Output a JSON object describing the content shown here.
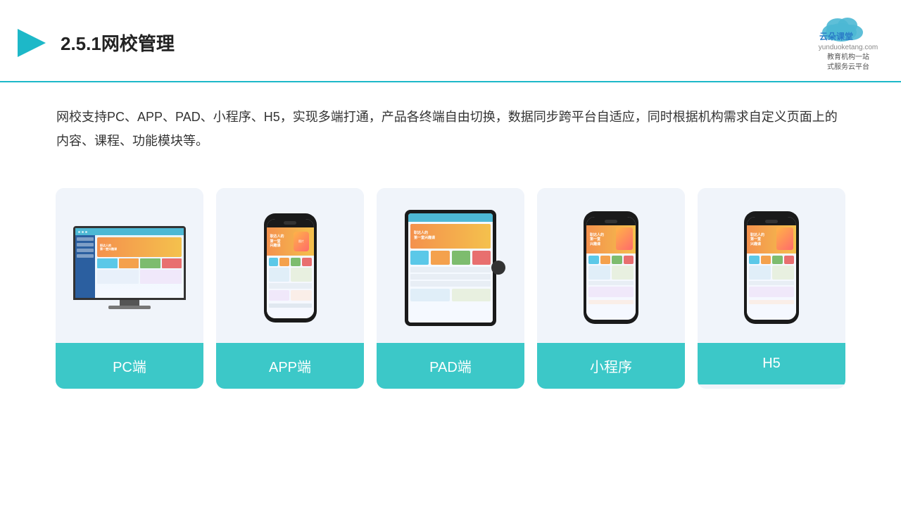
{
  "header": {
    "title": "2.5.1网校管理",
    "logo_name": "云朵课堂",
    "logo_url": "yunduoketang.com",
    "logo_tagline": "教育机构一站\n式服务云平台"
  },
  "description": {
    "text": "网校支持PC、APP、PAD、小程序、H5，实现多端打通，产品各终端自由切换，数据同步跨平台自适应，同时根据机构需求自定义页面上的内容、课程、功能模块等。"
  },
  "cards": [
    {
      "id": "pc",
      "label": "PC端"
    },
    {
      "id": "app",
      "label": "APP端"
    },
    {
      "id": "pad",
      "label": "PAD端"
    },
    {
      "id": "mini",
      "label": "小程序"
    },
    {
      "id": "h5",
      "label": "H5"
    }
  ],
  "colors": {
    "accent": "#3cc8c8",
    "header_border": "#1db8c8",
    "card_bg": "#f0f4fa"
  }
}
